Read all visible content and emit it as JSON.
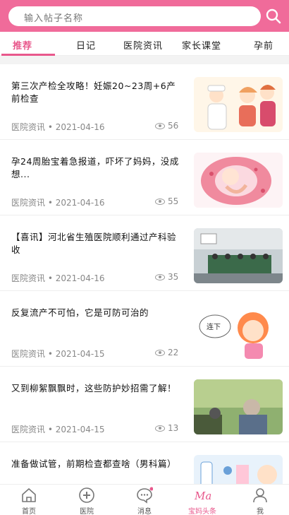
{
  "search": {
    "placeholder": "输入帖子名称"
  },
  "tabs": [
    {
      "label": "推荐",
      "active": true
    },
    {
      "label": "日记"
    },
    {
      "label": "医院资讯"
    },
    {
      "label": "家长课堂"
    },
    {
      "label": "孕前"
    }
  ],
  "feed": [
    {
      "title": "第三次产检全攻略！妊娠20~23周+6产前检查",
      "source": "医院资讯",
      "date": "2021-04-16",
      "views": "56"
    },
    {
      "title": "孕24周胎宝着急报道，吓坏了妈妈，没成想...",
      "source": "医院资讯",
      "date": "2021-04-16",
      "views": "55"
    },
    {
      "title": "【喜讯】河北省生殖医院顺利通过产科验收",
      "source": "医院资讯",
      "date": "2021-04-16",
      "views": "35"
    },
    {
      "title": "反复流产不可怕，它是可防可治的",
      "source": "医院资讯",
      "date": "2021-04-15",
      "views": "22",
      "bubble_text": "连下"
    },
    {
      "title": "又到柳絮飘飘时，这些防护妙招需了解！",
      "source": "医院资讯",
      "date": "2021-04-15",
      "views": "13"
    },
    {
      "title": "准备做试管，前期检查都查啥（男科篇）",
      "source": "",
      "date": "",
      "views": ""
    }
  ],
  "nav": [
    {
      "label": "首页",
      "icon": "home-icon"
    },
    {
      "label": "医院",
      "icon": "hospital-icon"
    },
    {
      "label": "消息",
      "icon": "message-icon",
      "badge": true
    },
    {
      "label": "宝妈头条",
      "icon": "ma-logo-icon",
      "active": true,
      "logo_text": "Ma"
    },
    {
      "label": "我",
      "icon": "user-icon"
    }
  ],
  "colors": {
    "brand": "#f06b9a",
    "accent": "#e8588c"
  }
}
